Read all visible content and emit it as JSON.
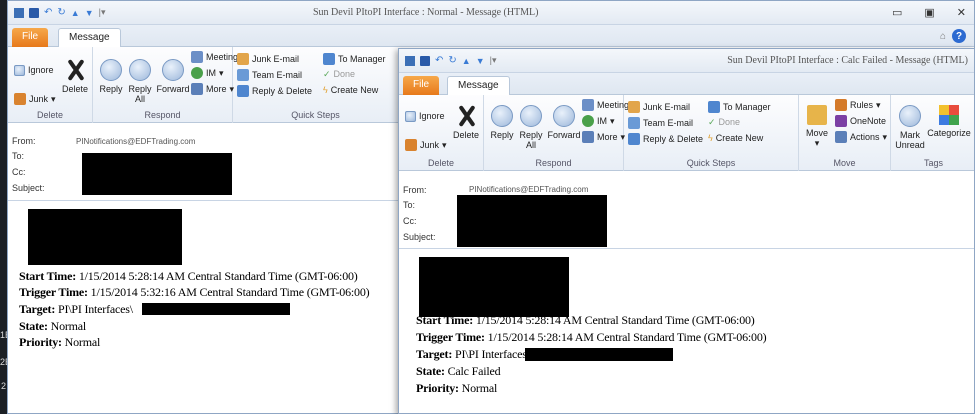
{
  "w1": {
    "title": "Sun Devil PItoPI Interface : Normal - Message (HTML)",
    "tabs": {
      "file": "File",
      "message": "Message"
    },
    "groups": {
      "delete": "Delete",
      "respond": "Respond",
      "quick_steps": "Quick Steps"
    },
    "btn": {
      "ignore": "Ignore",
      "junk": "Junk",
      "delete": "Delete",
      "reply": "Reply",
      "reply_all": "Reply All",
      "forward": "Forward",
      "meeting": "Meeting",
      "im": "IM",
      "more": "More",
      "junk_email": "Junk E-mail",
      "team_email": "Team E-mail",
      "reply_delete": "Reply & Delete",
      "to_manager": "To Manager",
      "done": "Done",
      "create_new": "Create New"
    },
    "hdr": {
      "from_label": "From:",
      "from_value": "PINotifications@EDFTrading.com",
      "to_label": "To:",
      "cc_label": "Cc:",
      "subject_label": "Subject:"
    },
    "body": {
      "start_label": "Start Time:",
      "start_value": "1/15/2014 5:28:14 AM Central Standard Time (GMT-06:00)",
      "trigger_label": "Trigger Time:",
      "trigger_value": "1/15/2014 5:32:16 AM Central Standard Time (GMT-06:00)",
      "target_label": "Target:",
      "target_value": "PI\\PI Interfaces\\",
      "state_label": "State:",
      "state_value": "Normal",
      "priority_label": "Priority:",
      "priority_value": "Normal"
    }
  },
  "w2": {
    "title": "Sun Devil PItoPI Interface : Calc Failed - Message (HTML)",
    "tabs": {
      "file": "File",
      "message": "Message"
    },
    "groups": {
      "delete": "Delete",
      "respond": "Respond",
      "quick_steps": "Quick Steps",
      "move": "Move",
      "tags": "Tags"
    },
    "btn": {
      "ignore": "Ignore",
      "junk": "Junk",
      "delete": "Delete",
      "reply": "Reply",
      "reply_all": "Reply All",
      "forward": "Forward",
      "meeting": "Meeting",
      "im": "IM",
      "more": "More",
      "junk_email": "Junk E-mail",
      "team_email": "Team E-mail",
      "reply_delete": "Reply & Delete",
      "to_manager": "To Manager",
      "done": "Done",
      "create_new": "Create New",
      "move": "Move",
      "rules": "Rules",
      "onenote": "OneNote",
      "actions": "Actions",
      "mark_unread": "Mark Unread",
      "categorize": "Categorize"
    },
    "hdr": {
      "from_label": "From:",
      "from_value": "PINotifications@EDFTrading.com",
      "to_label": "To:",
      "cc_label": "Cc:",
      "subject_label": "Subject:"
    },
    "body": {
      "start_label": "Start Time:",
      "start_value": "1/15/2014 5:28:14 AM Central Standard Time (GMT-06:00)",
      "trigger_label": "Trigger Time:",
      "trigger_value": "1/15/2014 5:28:14 AM Central Standard Time (GMT-06:00)",
      "target_label": "Target:",
      "target_value": "PI\\PI Interfaces",
      "state_label": "State:",
      "state_value": "Calc Failed",
      "priority_label": "Priority:",
      "priority_value": "Normal"
    }
  },
  "left_strip": {
    "a": "1B",
    "b": "2B",
    "c": "2"
  },
  "colors": {
    "file_tab": "#e7791b",
    "ribbon_bg": "#e8eef6",
    "help": "#2c6ad1",
    "desktop": "#1b1f24"
  }
}
